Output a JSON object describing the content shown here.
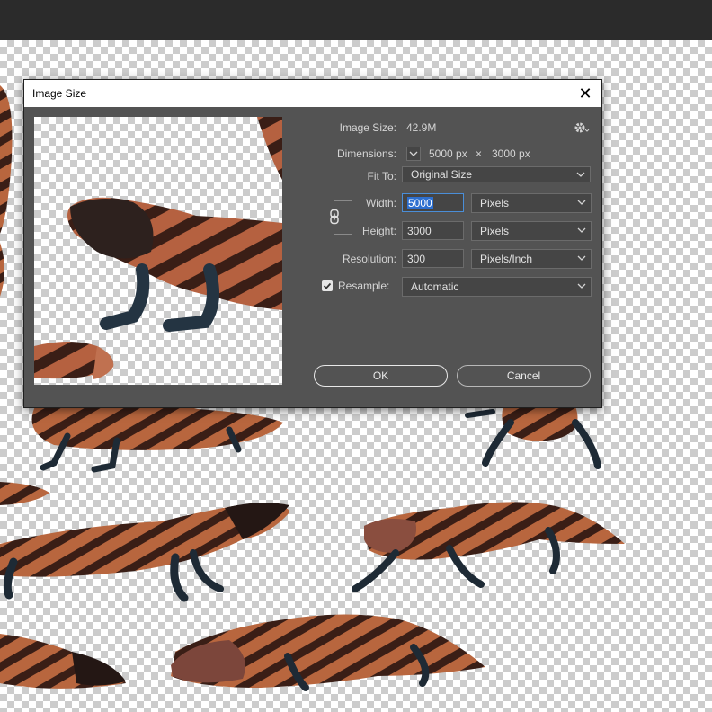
{
  "dialog": {
    "title": "Image Size",
    "close_glyph": "✕",
    "image_size_label": "Image Size:",
    "image_size_value": "42.9M",
    "dimensions_label": "Dimensions:",
    "dimensions_width": "5000 px",
    "dimensions_times": "×",
    "dimensions_height": "3000 px",
    "fit_to_label": "Fit To:",
    "fit_to_value": "Original Size",
    "width_label": "Width:",
    "width_value": "5000",
    "width_unit": "Pixels",
    "height_label": "Height:",
    "height_value": "3000",
    "height_unit": "Pixels",
    "resolution_label": "Resolution:",
    "resolution_value": "300",
    "resolution_unit": "Pixels/Inch",
    "resample_label": "Resample:",
    "resample_checked": true,
    "resample_value": "Automatic",
    "ok_label": "OK",
    "cancel_label": "Cancel"
  },
  "icons": {
    "gear": "gear-icon",
    "link": "link-icon",
    "close": "close-icon",
    "chevron": "chevron-down-icon"
  },
  "colors": {
    "dialog_bg": "#535353",
    "topbar_bg": "#2b2b2b",
    "field_bg": "#454545",
    "selection": "#2d6fcf",
    "lizard_body": "#b8663e",
    "lizard_band": "#3a1e16"
  }
}
